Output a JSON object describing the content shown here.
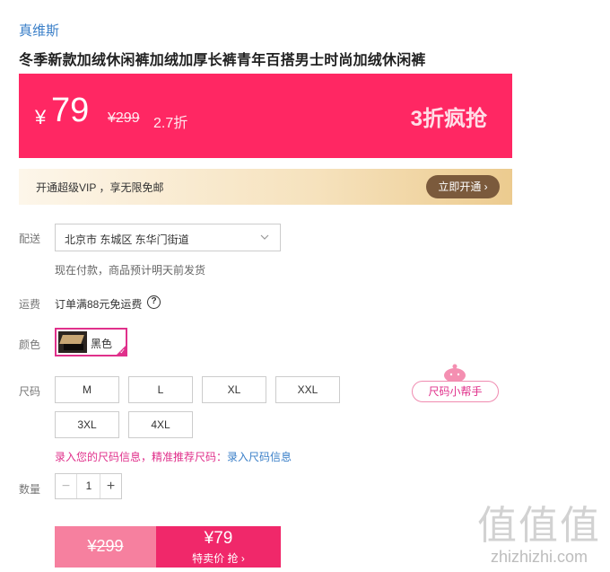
{
  "product": {
    "brand": "真维斯",
    "title": "冬季新款加绒休闲裤加绒加厚长裤青年百搭男士时尚加绒休闲裤"
  },
  "price": {
    "currency": "¥",
    "current": "79",
    "original": "¥299",
    "discount": "2.7折",
    "promo": "3折疯抢"
  },
  "vip": {
    "text": "开通超级VIP ，享无限免邮",
    "button": "立即开通 ›"
  },
  "delivery": {
    "label": "配送",
    "location": "北京市 东城区 东华门街道",
    "note": "现在付款，商品预计明天前发货"
  },
  "shipping": {
    "label": "运费",
    "text": "订单满88元免运费"
  },
  "color": {
    "label": "颜色",
    "selected": "黑色"
  },
  "size": {
    "label": "尺码",
    "options": [
      "M",
      "L",
      "XL",
      "XXL",
      "3XL",
      "4XL"
    ],
    "helper": "尺码小帮手",
    "hint_text": "录入您的尺码信息，精准推荐尺码：",
    "hint_link": "录入尺码信息"
  },
  "quantity": {
    "label": "数量",
    "value": "1",
    "minus": "−",
    "plus": "+"
  },
  "buy": {
    "original": "¥299",
    "price": "¥79",
    "sub": "特卖价 抢 ›"
  },
  "watermark": {
    "big": "值值值",
    "small": "zhizhizhi.com"
  },
  "colors": {
    "brand_blue": "#3a7fc8",
    "price_pink": "#ff2763",
    "accent_magenta": "#e0308b",
    "vip_brown": "#7b5a3c"
  }
}
